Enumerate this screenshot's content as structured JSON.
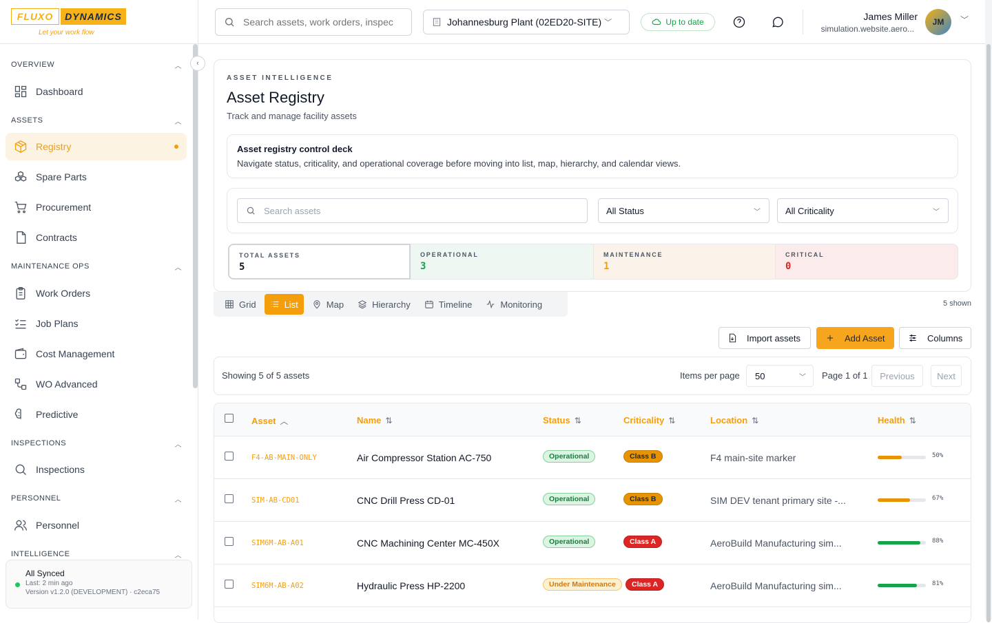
{
  "logo": {
    "part1": "FLUXO",
    "part2": "DYNAMICS",
    "tagline": "Let your work flow"
  },
  "sidebar": {
    "sections": {
      "overview": "OVERVIEW",
      "assets": "ASSETS",
      "maintenance": "MAINTENANCE OPS",
      "inspections": "INSPECTIONS",
      "personnel": "PERSONNEL",
      "intelligence": "INTELLIGENCE"
    },
    "items": {
      "dashboard": "Dashboard",
      "registry": "Registry",
      "spare_parts": "Spare Parts",
      "procurement": "Procurement",
      "contracts": "Contracts",
      "work_orders": "Work Orders",
      "job_plans": "Job Plans",
      "cost_management": "Cost Management",
      "wo_advanced": "WO Advanced",
      "predictive": "Predictive",
      "inspections": "Inspections",
      "personnel": "Personnel"
    },
    "sync": {
      "title": "All Synced",
      "last": "Last: 2 min ago",
      "version": "Version v1.2.0 (DEVELOPMENT) · c2eca75"
    }
  },
  "topbar": {
    "search_placeholder": "Search assets, work orders, inspec",
    "site": "Johannesburg Plant (02ED20-SITE)",
    "status": "Up to date",
    "user_name": "James Miller",
    "user_email": "simulation.website.aero...",
    "avatar": "JM"
  },
  "header": {
    "kicker": "ASSET INTELLIGENCE",
    "title": "Asset Registry",
    "subtitle": "Track and manage facility assets"
  },
  "deck": {
    "title": "Asset registry control deck",
    "text": "Navigate status, criticality, and operational coverage before moving into list, map, hierarchy, and calendar views."
  },
  "filters": {
    "search_placeholder": "Search assets",
    "status": "All Status",
    "criticality": "All Criticality"
  },
  "stats": [
    {
      "label": "TOTAL ASSETS",
      "value": "5",
      "color": "#111827"
    },
    {
      "label": "OPERATIONAL",
      "value": "3",
      "color": "#16a34a"
    },
    {
      "label": "MAINTENANCE",
      "value": "1",
      "color": "#f59e0b"
    },
    {
      "label": "CRITICAL",
      "value": "0",
      "color": "#dc2626"
    }
  ],
  "views": {
    "grid": "Grid",
    "list": "List",
    "map": "Map",
    "hierarchy": "Hierarchy",
    "timeline": "Timeline",
    "monitoring": "Monitoring",
    "shown": "5 shown"
  },
  "actions": {
    "import": "Import assets",
    "add": "Add Asset",
    "columns": "Columns"
  },
  "pager": {
    "showing": "Showing 5 of 5 assets",
    "per_page_label": "Items per page",
    "per_page": "50",
    "page": "Page 1 of 1",
    "prev": "Previous",
    "next": "Next"
  },
  "table": {
    "headers": {
      "asset": "Asset",
      "name": "Name",
      "status": "Status",
      "criticality": "Criticality",
      "location": "Location",
      "health": "Health"
    },
    "rows": [
      {
        "id": "F4-AB-MAIN-ONLY",
        "name": "Air Compressor Station AC-750",
        "status": "Operational",
        "crit": "Class B",
        "location": "F4 main-site marker",
        "health": 50,
        "health_label": "50%"
      },
      {
        "id": "SIM-AB-CD01",
        "name": "CNC Drill Press CD-01",
        "status": "Operational",
        "crit": "Class B",
        "location": "SIM DEV tenant primary site -...",
        "health": 67,
        "health_label": "67%"
      },
      {
        "id": "SIM6M-AB-A01",
        "name": "CNC Machining Center MC-450X",
        "status": "Operational",
        "crit": "Class A",
        "location": "AeroBuild Manufacturing sim...",
        "health": 88,
        "health_label": "88%"
      },
      {
        "id": "SIM6M-AB-A02",
        "name": "Hydraulic Press HP-2200",
        "status": "Under Maintenance",
        "crit": "Class A",
        "location": "AeroBuild Manufacturing sim...",
        "health": 81,
        "health_label": "81%"
      }
    ]
  }
}
